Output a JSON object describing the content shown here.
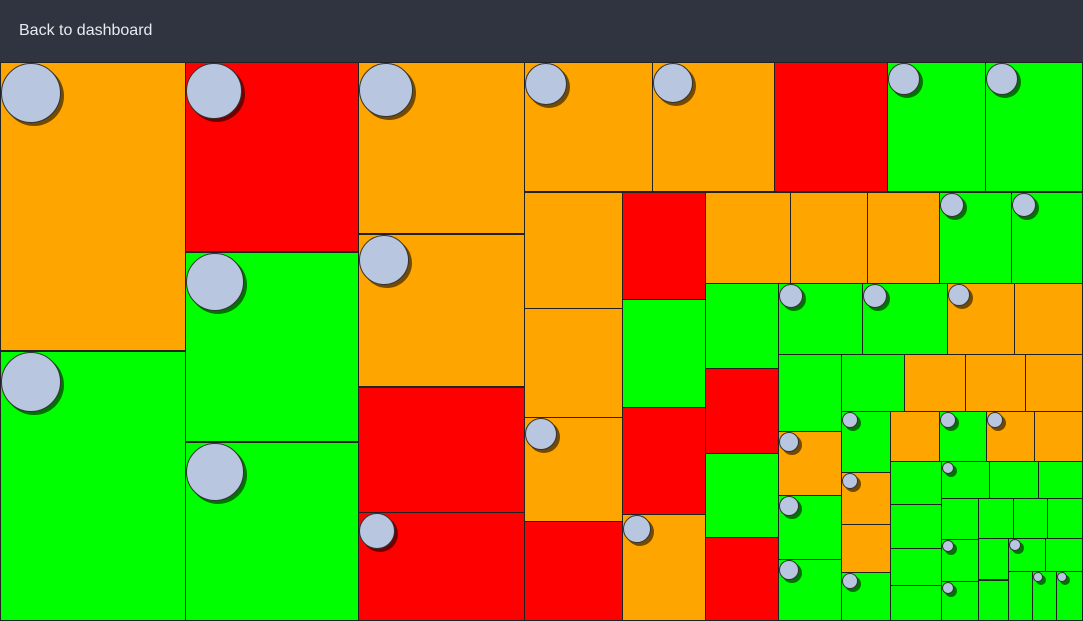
{
  "header": {
    "back_label": "Back to dashboard"
  },
  "colors": {
    "header_bg": "#2f3440",
    "header_text": "#e8eaee",
    "dot_fill": "#b8c6e0",
    "status": {
      "orange": "#ffa500",
      "red": "#ff0000",
      "green": "#00ff00"
    }
  },
  "treemap": {
    "tile_count": 72,
    "marker_count": 34
  }
}
